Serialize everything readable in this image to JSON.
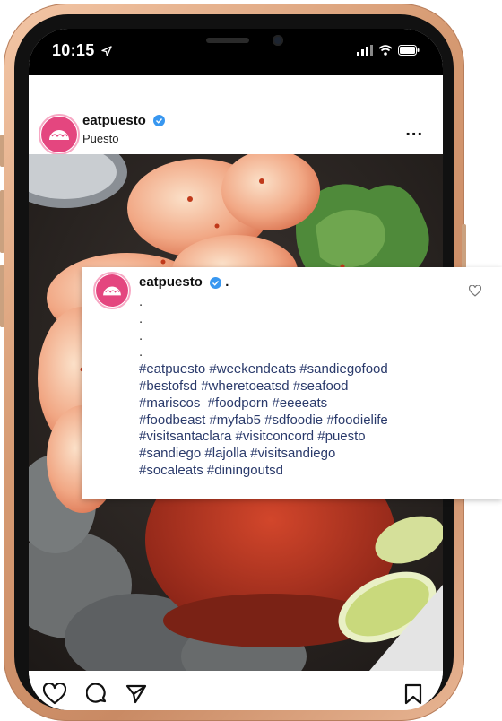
{
  "status_bar": {
    "time": "10:15",
    "icons": [
      "location-arrow-icon",
      "signal-icon",
      "wifi-icon",
      "battery-icon"
    ]
  },
  "post": {
    "username": "eatpuesto",
    "subtitle": "Puesto",
    "verified": true,
    "more_label": "..."
  },
  "caption": {
    "username": "eatpuesto",
    "suffix": ".",
    "dots": [
      ".",
      ".",
      ".",
      "."
    ],
    "hashtag_lines": [
      "#eatpuesto #weekendeats #sandiegofood",
      "#bestofsd #wheretoeatsd #seafood",
      "#mariscos  #foodporn #eeeeats",
      "#foodbeast #myfab5 #sdfoodie #foodielife",
      "#visitsantaclara #visitconcord #puesto",
      "#sandiego #lajolla #visitsandiego",
      "#socaleats #diningoutsd"
    ]
  },
  "actions": [
    "heart-icon",
    "comment-icon",
    "send-icon",
    "bookmark-icon"
  ],
  "colors": {
    "brand_pink": "#e4467f",
    "verified_blue": "#3897f0",
    "hashtag_blue": "#2a3a6b",
    "phone_frame": "#d69a72"
  }
}
